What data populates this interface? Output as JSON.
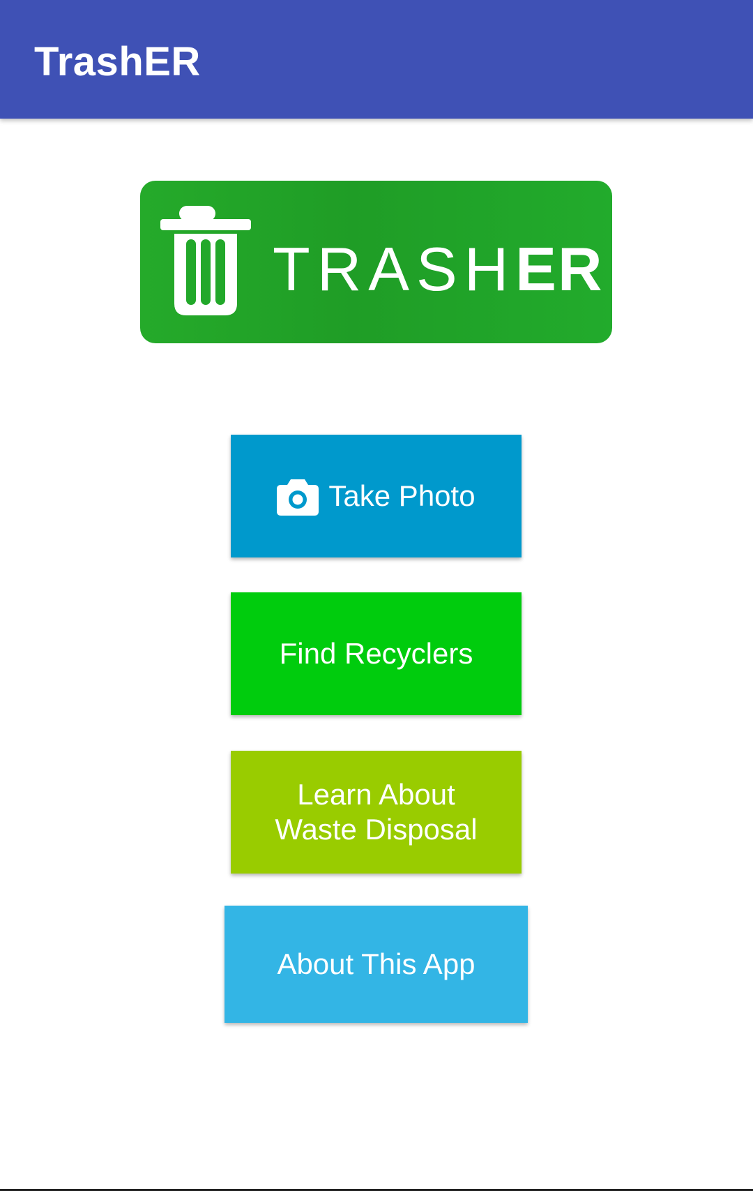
{
  "app_bar": {
    "title": "TrashER",
    "background": "#3f51b5"
  },
  "logo": {
    "word_light": "TRASH",
    "word_bold": "ER",
    "icon": "trash-can-icon",
    "background": "#22a82a"
  },
  "buttons": {
    "take_photo": {
      "label": "Take Photo",
      "icon": "camera-icon",
      "color": "#0099cc"
    },
    "find_recyclers": {
      "label": "Find Recyclers",
      "color": "#00cc0d"
    },
    "learn_waste": {
      "line1": "Learn About",
      "line2": "Waste Disposal",
      "color": "#99cc00"
    },
    "about_app": {
      "label": "About This App",
      "color": "#33b5e5"
    }
  }
}
